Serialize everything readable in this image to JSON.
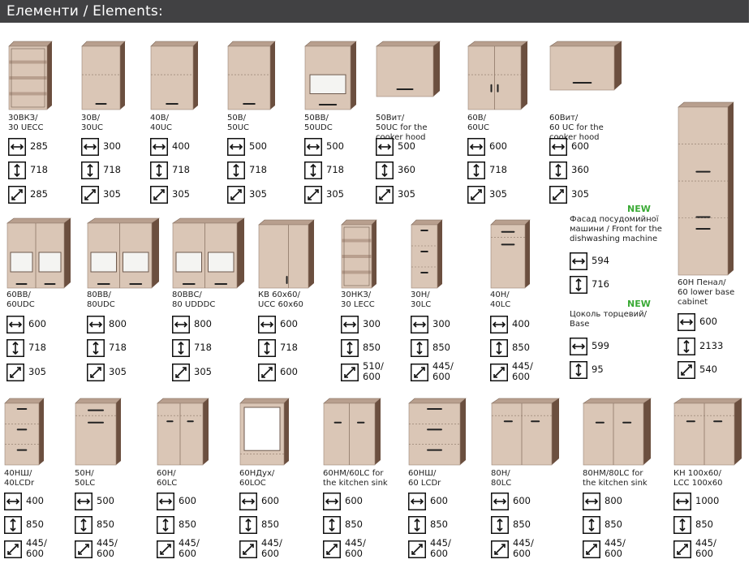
{
  "header": {
    "title": "Елементи / Elements:"
  },
  "icons": {
    "width": "width-arrow-icon",
    "height": "height-arrow-icon",
    "depth": "depth-arrow-icon"
  },
  "colors": {
    "header_bg": "#414143",
    "new_badge": "#3aaa35",
    "cabinet_face": "#dac6b6",
    "cabinet_side": "#6b4f3f"
  },
  "items": [
    {
      "label": "30ВКЗ/\n30 UECC",
      "width": "285",
      "height": "718",
      "depth": "285",
      "kind": "open-corner-wall"
    },
    {
      "label": "30В/\n30UC",
      "width": "300",
      "height": "718",
      "depth": "305",
      "kind": "wall-1door"
    },
    {
      "label": "40В/\n40UC",
      "width": "400",
      "height": "718",
      "depth": "305",
      "kind": "wall-1door"
    },
    {
      "label": "50В/\n50UC",
      "width": "500",
      "height": "718",
      "depth": "305",
      "kind": "wall-1door"
    },
    {
      "label": "50ВВ/\n50UDC",
      "width": "500",
      "height": "718",
      "depth": "305",
      "kind": "wall-glass"
    },
    {
      "label": "50Вит/\n50UC for the\ncooker hood",
      "width": "500",
      "height": "360",
      "depth": "305",
      "kind": "wall-hood"
    },
    {
      "label": "60В/\n60UC",
      "width": "600",
      "height": "718",
      "depth": "305",
      "kind": "wall-2door"
    },
    {
      "label": "60Вит/\n60 UC for the\ncooker hood",
      "width": "600",
      "height": "360",
      "depth": "305",
      "kind": "wall-hood"
    },
    {
      "label": "60Н Пенал/\n60 lower base\ncabinet",
      "width": "600",
      "height": "2133",
      "depth": "540",
      "kind": "tall"
    },
    {
      "label": "60ВВ/\n60UDC",
      "width": "600",
      "height": "718",
      "depth": "305",
      "kind": "wall-glass2"
    },
    {
      "label": "80ВВ/\n80UDC",
      "width": "800",
      "height": "718",
      "depth": "305",
      "kind": "wall-glass2"
    },
    {
      "label": "80ВВС/\n80 UDDDC",
      "width": "800",
      "height": "718",
      "depth": "305",
      "kind": "wall-glass2"
    },
    {
      "label": "КВ 60х60/\nUCC 60х60",
      "width": "600",
      "height": "718",
      "depth": "600",
      "kind": "corner-wall"
    },
    {
      "label": "30НКЗ/\n30 LECC",
      "width": "300",
      "height": "850",
      "depth": "510/\n600",
      "kind": "open-corner-base"
    },
    {
      "label": "30Н/\n30LC",
      "width": "300",
      "height": "850",
      "depth": "445/\n600",
      "kind": "base-drawers"
    },
    {
      "label": "40Н/\n40LC",
      "width": "400",
      "height": "850",
      "depth": "445/\n600",
      "kind": "base-1door"
    },
    {
      "label": "40НШ/\n40LCDr",
      "width": "400",
      "height": "850",
      "depth": "445/\n600",
      "kind": "base-drawers"
    },
    {
      "label": "50Н/\n50LC",
      "width": "500",
      "height": "850",
      "depth": "445/\n600",
      "kind": "base-1door"
    },
    {
      "label": "60Н/\n60LC",
      "width": "600",
      "height": "850",
      "depth": "445/\n600",
      "kind": "base-2door"
    },
    {
      "label": "60НДух/\n60LOC",
      "width": "600",
      "height": "850",
      "depth": "445/\n600",
      "kind": "oven"
    },
    {
      "label": "60НМ/60LC for\nthe kitchen sink",
      "width": "600",
      "height": "850",
      "depth": "445/\n600",
      "kind": "sink"
    },
    {
      "label": "60НШ/\n60 LCDr",
      "width": "600",
      "height": "850",
      "depth": "445/\n600",
      "kind": "base-drawers"
    },
    {
      "label": "80Н/\n80LC",
      "width": "600",
      "height": "850",
      "depth": "445/\n600",
      "kind": "base-2door"
    },
    {
      "label": "80НМ/80LC for\nthe kitchen sink",
      "width": "800",
      "height": "850",
      "depth": "445/\n600",
      "kind": "sink"
    },
    {
      "label": "КН 100х60/\nLCC 100х60",
      "width": "1000",
      "height": "850",
      "depth": "445/\n600",
      "kind": "base-2door"
    }
  ],
  "specials": [
    {
      "badge": "NEW",
      "label": "Фасад посудомийної\nмашини / Front for the\ndishwashing machine",
      "width": "594",
      "height": "716"
    },
    {
      "badge": "NEW",
      "label": "Цоколь торцевий/\nBase",
      "width": "599",
      "height": "95"
    }
  ]
}
